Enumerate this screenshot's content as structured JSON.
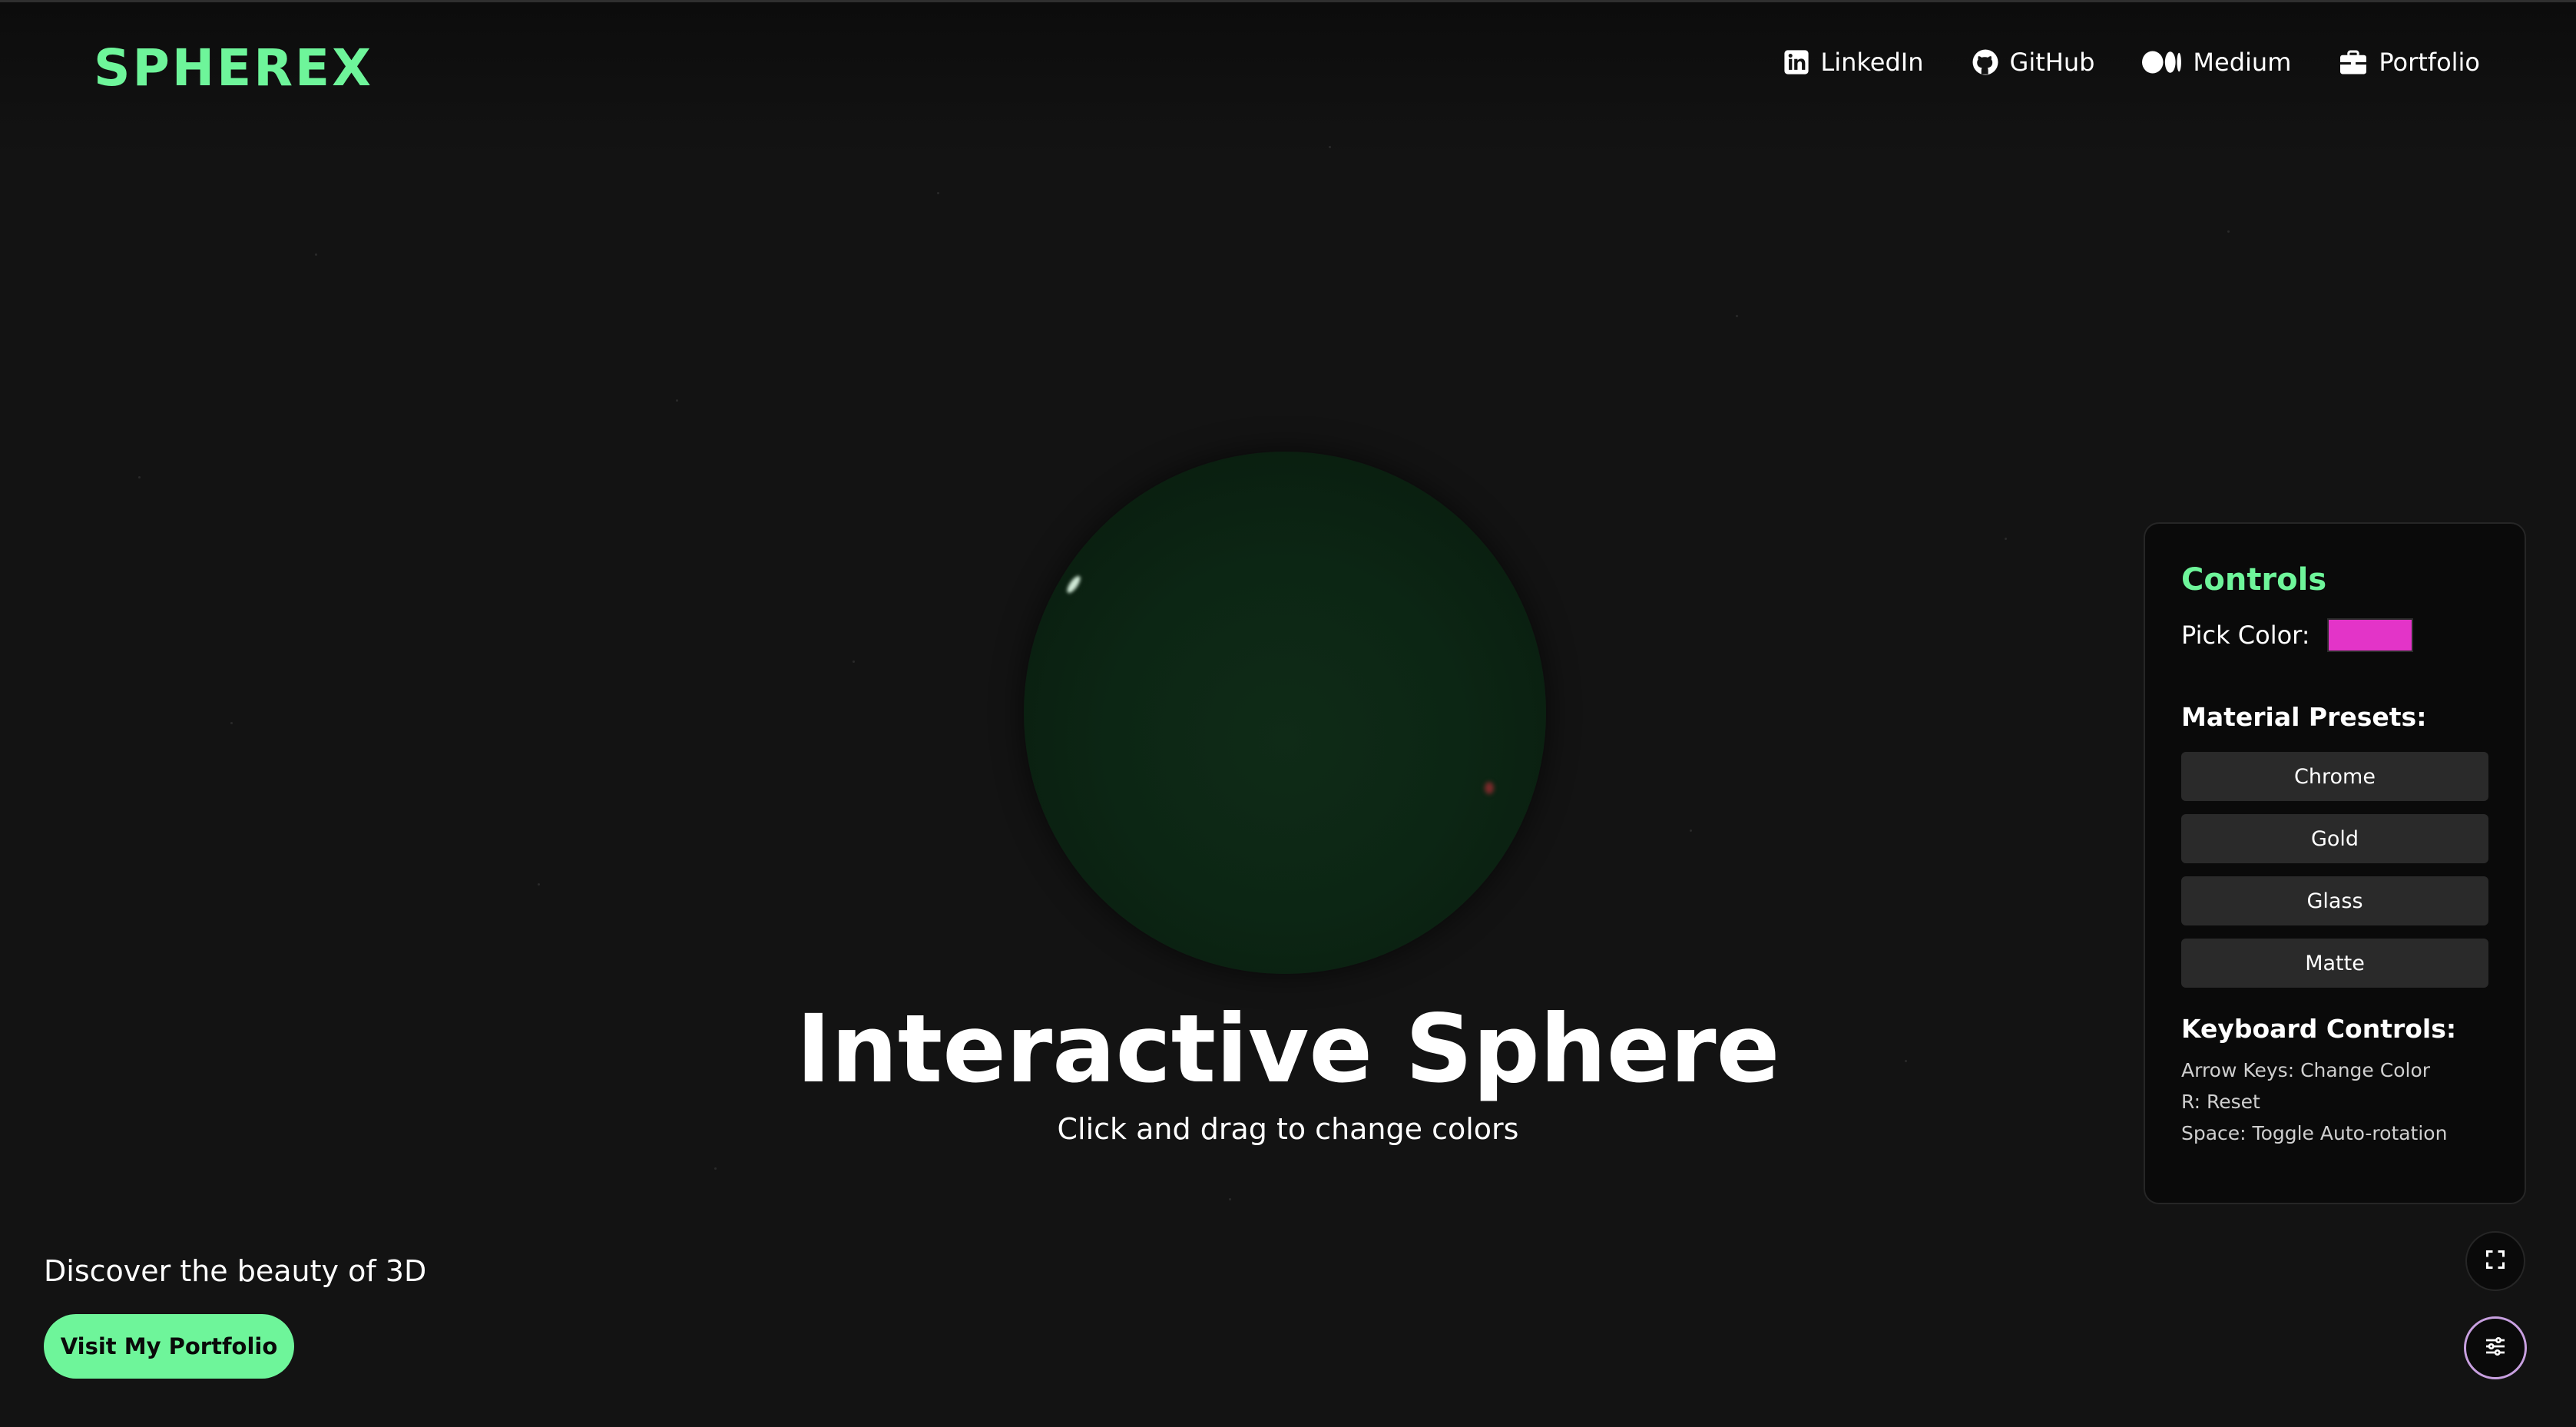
{
  "app": {
    "logo": "SPHEREX"
  },
  "nav": {
    "items": [
      {
        "label": "LinkedIn",
        "icon": "linkedin-icon"
      },
      {
        "label": "GitHub",
        "icon": "github-icon"
      },
      {
        "label": "Medium",
        "icon": "medium-icon"
      },
      {
        "label": "Portfolio",
        "icon": "briefcase-icon"
      }
    ]
  },
  "hero": {
    "title": "Interactive Sphere",
    "subtitle": "Click and drag to change colors"
  },
  "footer": {
    "tagline": "Discover the beauty of 3D",
    "cta_label": "Visit My Portfolio"
  },
  "controls": {
    "title": "Controls",
    "pick_color_label": "Pick Color:",
    "pick_color_value": "#e334c8",
    "presets_title": "Material Presets:",
    "presets": [
      "Chrome",
      "Gold",
      "Glass",
      "Matte"
    ],
    "keyboard_title": "Keyboard Controls:",
    "keyboard_items": [
      "Arrow Keys: Change Color",
      "R: Reset",
      "Space: Toggle Auto-rotation"
    ]
  },
  "buttons": {
    "fullscreen_icon": "fullscreen-icon",
    "settings_icon": "sliders-icon"
  },
  "colors": {
    "accent": "#6ef59a",
    "background": "#131313",
    "panel": "#0a0a0a",
    "sphere": "#0c2614",
    "swatch": "#e334c8",
    "settings_ring": "#c8a0e0"
  }
}
